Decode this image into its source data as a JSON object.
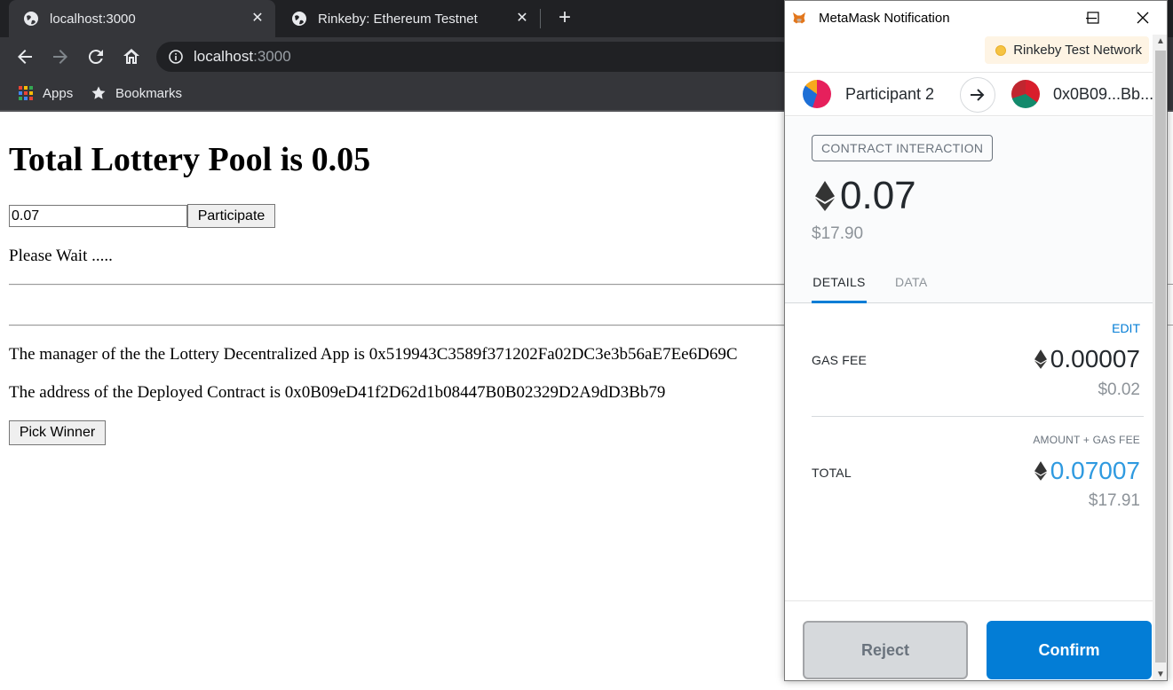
{
  "browser": {
    "tabs": [
      {
        "title": "localhost:3000"
      },
      {
        "title": "Rinkeby: Ethereum Testnet"
      }
    ],
    "close_glyph": "✕",
    "new_tab_glyph": "+",
    "address": {
      "host": "localhost",
      "port": ":3000"
    },
    "bookmarks": [
      {
        "label": "Apps",
        "icon": "apps-grid-icon"
      },
      {
        "label": "Bookmarks",
        "icon": "star-icon"
      }
    ]
  },
  "page": {
    "heading": "Total Lottery Pool is 0.05",
    "amount_value": "0.07",
    "participate_label": "Participate",
    "status": "Please Wait .....",
    "manager_text": "The manager of the the Lottery Decentralized App is 0x519943C3589f371202Fa02DC3e3b56aE7Ee6D69C",
    "contract_text": "The address of the Deployed Contract is 0x0B09eD41f2D62d1b08447B0B02329D2A9dD3Bb79",
    "pick_winner_label": "Pick Winner"
  },
  "metamask": {
    "window_title": "MetaMask Notification",
    "network": "Rinkeby Test Network",
    "from_account": "Participant 2",
    "to_address": "0x0B09...Bb...",
    "interaction_badge": "CONTRACT INTERACTION",
    "amount_eth": "0.07",
    "amount_usd": "$17.90",
    "tabs": {
      "details": "DETAILS",
      "data": "DATA"
    },
    "edit_label": "EDIT",
    "gas_fee_label": "GAS FEE",
    "gas_fee_eth": "0.00007",
    "gas_fee_usd": "$0.02",
    "amount_plus_gas_label": "AMOUNT + GAS FEE",
    "total_label": "TOTAL",
    "total_eth": "0.07007",
    "total_usd": "$17.91",
    "reject_label": "Reject",
    "confirm_label": "Confirm"
  },
  "colors": {
    "metamask_blue": "#037dd6",
    "total_blue": "#2f9ae0",
    "network_dot": "#f6c343",
    "chrome_dark": "#202124",
    "chrome_toolbar": "#35363a"
  }
}
